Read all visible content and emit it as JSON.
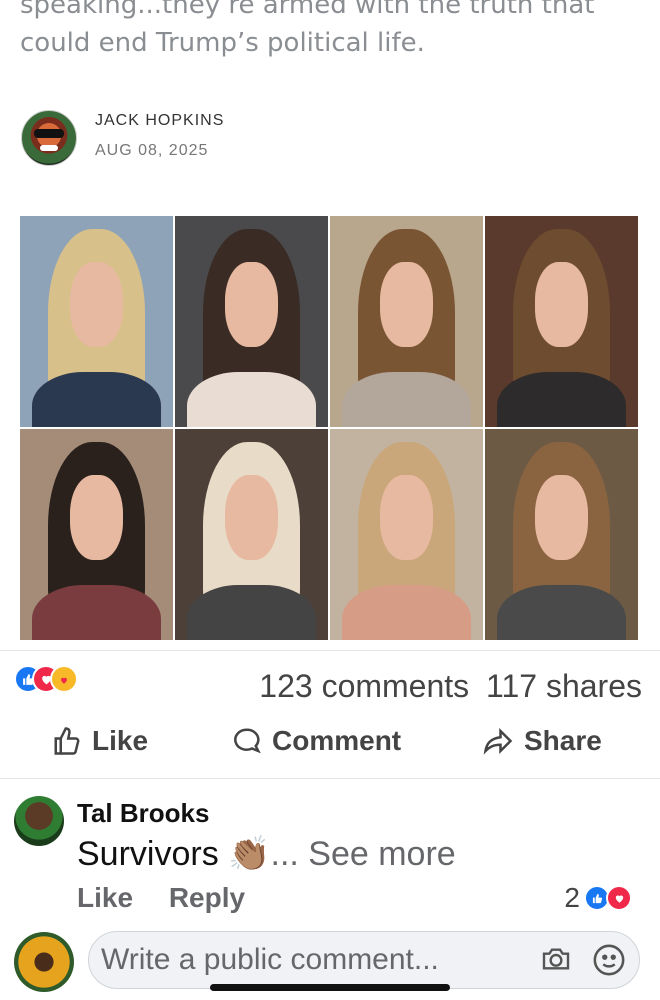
{
  "article": {
    "text_line1": "speaking...they’re armed with the truth that",
    "text_line2": "could end Trump’s political life."
  },
  "author": {
    "name": "JACK HOPKINS",
    "date": "AUG 08, 2025"
  },
  "photos": [
    {
      "bg": "#8fa3b8",
      "hair": "#d8c08a",
      "body": "#2a3850"
    },
    {
      "bg": "#4a4a4c",
      "hair": "#3a2c25",
      "body": "#e8dcd3"
    },
    {
      "bg": "#b9a78d",
      "hair": "#7a5534",
      "body": "#b3a69a"
    },
    {
      "bg": "#5a3a2c",
      "hair": "#6e4c30",
      "body": "#2e2b2c"
    },
    {
      "bg": "#a48c78",
      "hair": "#2a201c",
      "body": "#7a3c3e"
    },
    {
      "bg": "#4d4038",
      "hair": "#e8dcc8",
      "body": "#444"
    },
    {
      "bg": "#c2b3a0",
      "hair": "#c9a77a",
      "body": "#d79c86"
    },
    {
      "bg": "#6d5a45",
      "hair": "#8a6440",
      "body": "#4a4a4a"
    }
  ],
  "reactions": {
    "icons": [
      "like-icon",
      "love-icon",
      "care-icon"
    ],
    "comments": "123 comments",
    "shares": "117 shares"
  },
  "actions": {
    "like": "Like",
    "comment": "Comment",
    "share": "Share"
  },
  "comment": {
    "author": "Tal Brooks",
    "text": "Survivors",
    "emoji": "👏🏽",
    "see_more": "... See more",
    "like": "Like",
    "reply": "Reply",
    "reaction_count": "2"
  },
  "composer": {
    "placeholder": "Write a public comment..."
  },
  "colors": {
    "like_blue": "#1877f2",
    "love_red": "#f02849",
    "secondary_text": "#65676b"
  }
}
